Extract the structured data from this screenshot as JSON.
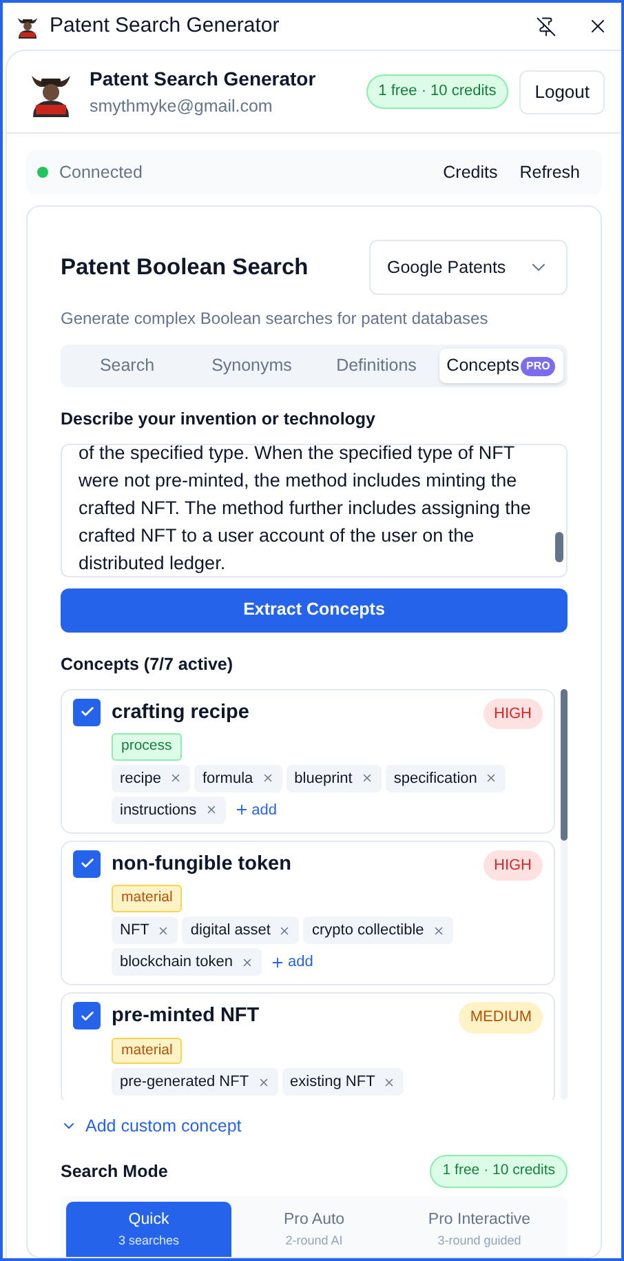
{
  "window": {
    "title": "Patent Search Generator"
  },
  "header": {
    "name": "Patent Search Generator",
    "email": "smythmyke@gmail.com",
    "badge": "1 free · 10 credits",
    "logout": "Logout"
  },
  "status": {
    "connected": true,
    "label": "Connected",
    "actions": [
      "Credits",
      "Refresh"
    ]
  },
  "search": {
    "title": "Patent Boolean Search",
    "database": "Google Patents",
    "subtitle": "Generate complex Boolean searches for patent databases",
    "tabs": [
      {
        "label": "Search",
        "selected": false
      },
      {
        "label": "Synonyms",
        "selected": false
      },
      {
        "label": "Definitions",
        "selected": false
      },
      {
        "label": "Concepts",
        "selected": true,
        "badge": "PRO"
      }
    ],
    "description_label": "Describe your invention or technology",
    "description": "of the specified type. When the specified type of NFT were not pre-minted, the method includes minting the crafted NFT. The method further includes assigning the crafted NFT to a user account of the user on the distributed ledger.",
    "extract_button": "Extract Concepts",
    "concepts_label": "Concepts (7/7 active)",
    "concepts": [
      {
        "name": "crafting recipe",
        "checked": true,
        "priority": {
          "label": "HIGH",
          "kind": "high"
        },
        "tag": {
          "label": "process",
          "kind": "process"
        },
        "synonyms": [
          "recipe",
          "formula",
          "blueprint",
          "specification",
          "instructions"
        ],
        "add": "add"
      },
      {
        "name": "non-fungible token",
        "checked": true,
        "priority": {
          "label": "HIGH",
          "kind": "high"
        },
        "tag": {
          "label": "material",
          "kind": "material"
        },
        "synonyms": [
          "NFT",
          "digital asset",
          "crypto collectible",
          "blockchain token"
        ],
        "add": "add"
      },
      {
        "name": "pre-minted NFT",
        "checked": true,
        "priority": {
          "label": "MEDIUM",
          "kind": "medium"
        },
        "tag": {
          "label": "material",
          "kind": "material"
        },
        "synonyms": [
          "pre-generated NFT",
          "existing NFT"
        ]
      }
    ],
    "add_custom": "Add custom concept",
    "mode_label": "Search Mode",
    "mode_badge": "1 free · 10 credits",
    "modes": [
      {
        "title": "Quick",
        "subtitle": "3 searches",
        "selected": true
      },
      {
        "title": "Pro Auto",
        "subtitle": "2-round AI",
        "selected": false
      },
      {
        "title": "Pro Interactive",
        "subtitle": "3-round guided",
        "selected": false
      }
    ]
  }
}
